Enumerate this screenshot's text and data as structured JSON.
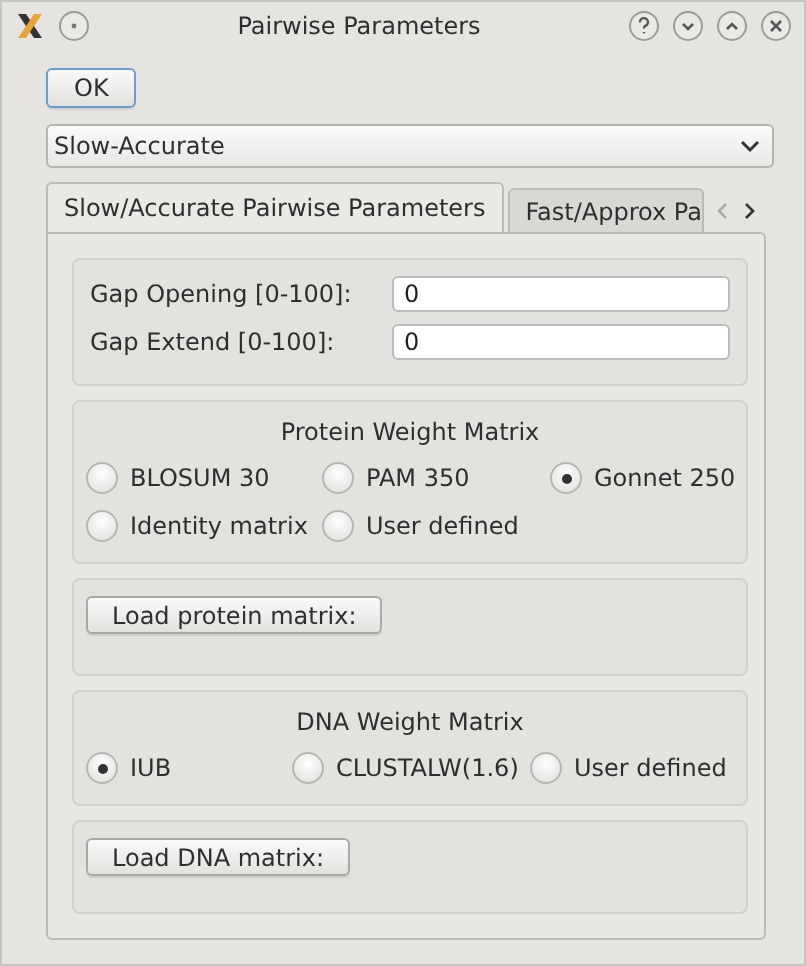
{
  "window": {
    "title": "Pairwise Parameters"
  },
  "ok_button": "OK",
  "mode_select": {
    "value": "Slow-Accurate"
  },
  "tabs": [
    {
      "label": "Slow/Accurate Pairwise Parameters",
      "selected": true
    },
    {
      "label": "Fast/Approx Pa",
      "selected": false
    }
  ],
  "gap_fields": [
    {
      "label": "Gap Opening [0-100]:",
      "value": "0"
    },
    {
      "label": "Gap Extend [0-100]:",
      "value": "0"
    }
  ],
  "protein_matrix": {
    "title": "Protein Weight Matrix",
    "options": [
      {
        "label": "BLOSUM 30",
        "selected": false
      },
      {
        "label": "PAM 350",
        "selected": false
      },
      {
        "label": "Gonnet 250",
        "selected": true
      },
      {
        "label": "Identity matrix",
        "selected": false
      },
      {
        "label": "User defined",
        "selected": false
      }
    ]
  },
  "load_protein_button": "Load protein matrix:",
  "dna_matrix": {
    "title": "DNA Weight Matrix",
    "options": [
      {
        "label": "IUB",
        "selected": true
      },
      {
        "label": "CLUSTALW(1.6)",
        "selected": false
      },
      {
        "label": "User defined",
        "selected": false
      }
    ]
  },
  "load_dna_button": "Load DNA matrix:"
}
